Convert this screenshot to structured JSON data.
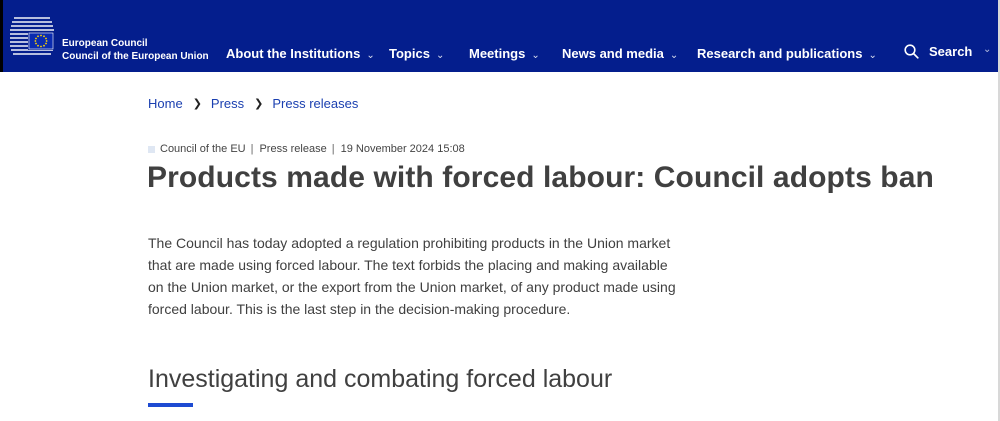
{
  "header": {
    "org_line1": "European Council",
    "org_line2": "Council of the European Union",
    "nav": [
      {
        "label": "About the Institutions"
      },
      {
        "label": "Topics"
      },
      {
        "label": "Meetings"
      },
      {
        "label": "News and media"
      },
      {
        "label": "Research and publications"
      }
    ],
    "search_label": "Search",
    "logo_icon": "eu-stars-logo-icon",
    "colors": {
      "bar": "#041e8d",
      "accent": "#1e4bd2",
      "link": "#1a3fb0"
    }
  },
  "breadcrumb": [
    "Home",
    "Press",
    "Press releases"
  ],
  "meta": {
    "source": "Council of the EU",
    "type": "Press release",
    "datetime": "19 November 2024 15:08"
  },
  "article": {
    "title": "Products made with forced labour: Council adopts ban",
    "lead": "The Council has today adopted a regulation prohibiting products in the Union market that are made using forced labour. The text forbids the placing and making available on the Union market, or the export from the Union market, of any product made using forced labour. This is the last step in the decision-making procedure.",
    "section_heading": "Investigating and combating forced labour"
  }
}
